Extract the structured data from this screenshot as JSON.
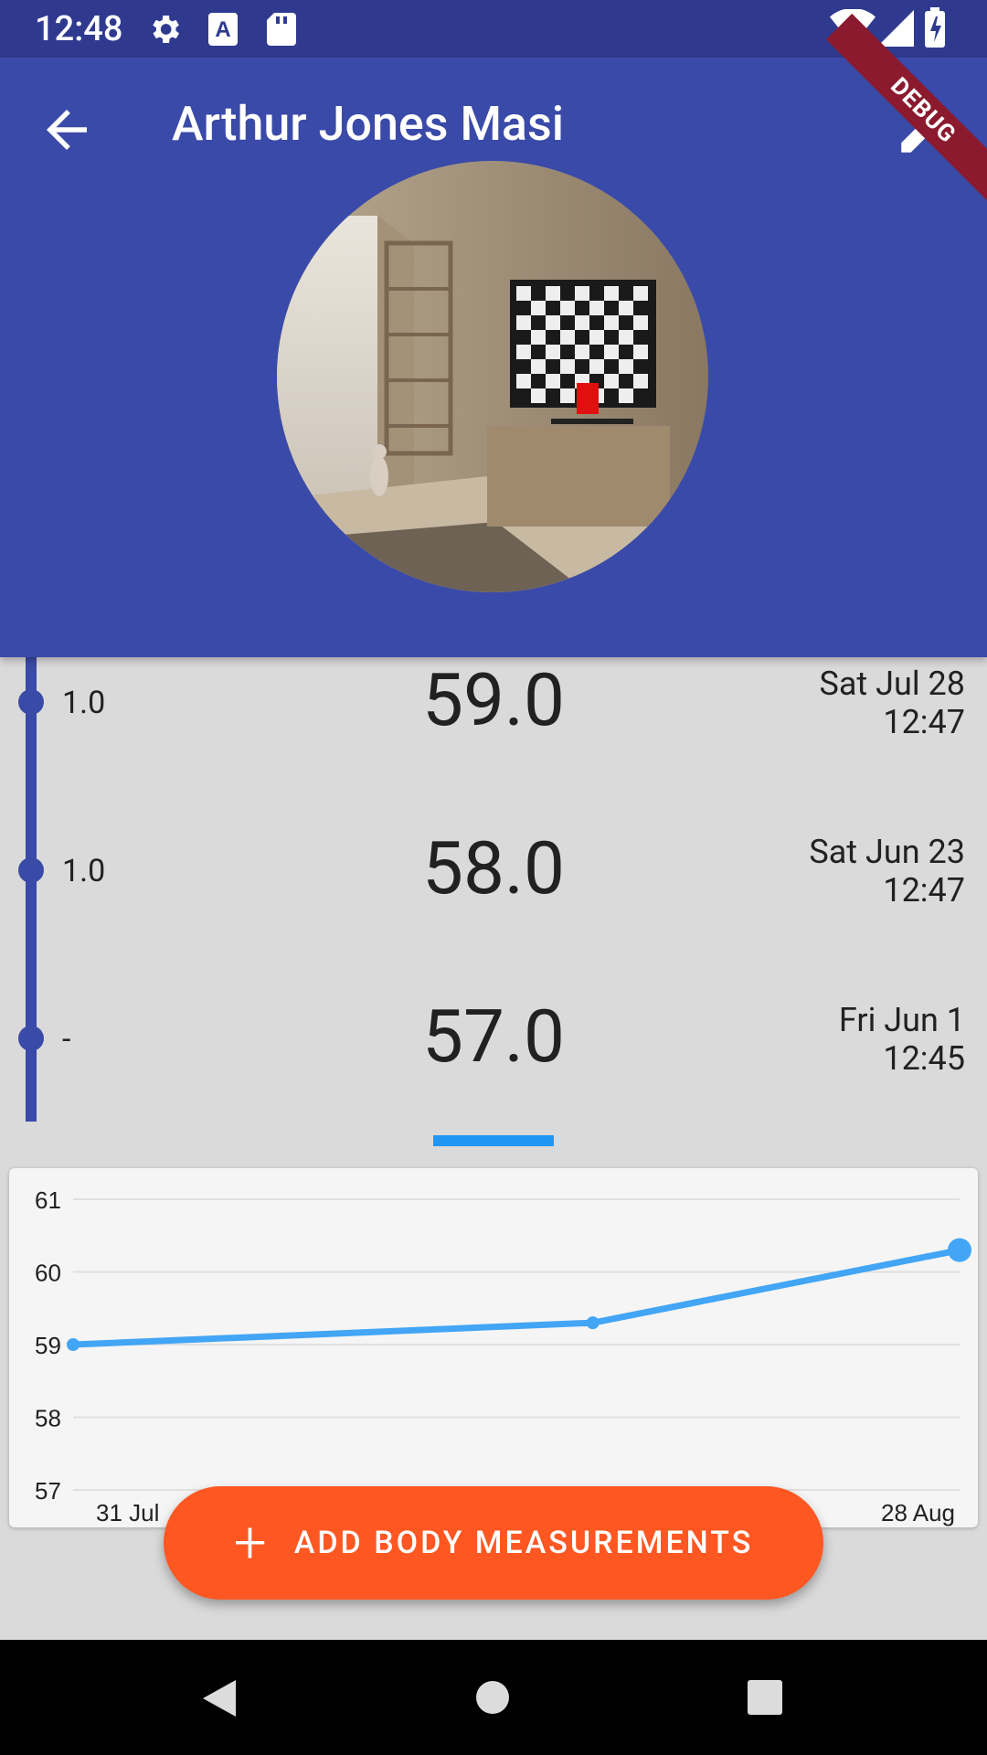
{
  "status_bar": {
    "time": "12:48",
    "icons": [
      "gear-icon",
      "a-icon",
      "sd-card-icon",
      "wifi-icon",
      "signal-icon",
      "battery-charging-icon"
    ]
  },
  "app_bar": {
    "title": "Arthur Jones Masi",
    "back_icon": "arrow-back-icon",
    "edit_icon": "pencil-icon",
    "color": "#3a4aa8"
  },
  "debug_banner": "DEBUG",
  "measurements": [
    {
      "delta": "1.0",
      "value": "59.0",
      "date": "Sat Jul 28",
      "time": "12:47"
    },
    {
      "delta": "1.0",
      "value": "58.0",
      "date": "Sat Jun 23",
      "time": "12:47"
    },
    {
      "delta": "-",
      "value": "57.0",
      "date": "Fri Jun 1",
      "time": "12:45"
    }
  ],
  "chart_data": {
    "type": "line",
    "x_tick_labels": [
      "31 Jul",
      "28 Aug"
    ],
    "y_ticks": [
      57,
      58,
      59,
      60,
      61
    ],
    "ylim": [
      57,
      61
    ],
    "series": [
      {
        "x": [
          "2018-07-31",
          "2018-08-17",
          "2018-08-29"
        ],
        "values": [
          59.0,
          59.3,
          60.3
        ]
      }
    ],
    "grid": true,
    "color": "#42a5f5"
  },
  "fab": {
    "label": "ADD BODY MEASUREMENTS",
    "icon": "plus-icon",
    "color": "#ff5722"
  },
  "nav_bar": {
    "icons": [
      "back-triangle-icon",
      "home-circle-icon",
      "recents-square-icon"
    ]
  }
}
